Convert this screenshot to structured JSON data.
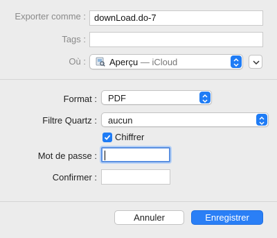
{
  "save_as": {
    "label": "Exporter comme :",
    "value": "downLoad.do-7"
  },
  "tags": {
    "label": "Tags :",
    "value": ""
  },
  "where": {
    "label": "Où :",
    "location": "Aperçu",
    "separator": " — ",
    "service": "iCloud",
    "icon": "preview-app-icon"
  },
  "format": {
    "label": "Format :",
    "selected": "PDF"
  },
  "quartz_filter": {
    "label": "Filtre Quartz :",
    "selected": "aucun"
  },
  "encrypt": {
    "label": "Chiffrer",
    "checked": true
  },
  "password": {
    "label": "Mot de passe :",
    "value": ""
  },
  "confirm": {
    "label": "Confirmer :",
    "value": ""
  },
  "buttons": {
    "cancel": "Annuler",
    "save": "Enregistrer"
  },
  "colors": {
    "accent": "#1f7cf5",
    "primary_button": "#2a7ff6",
    "background": "#ececec"
  }
}
